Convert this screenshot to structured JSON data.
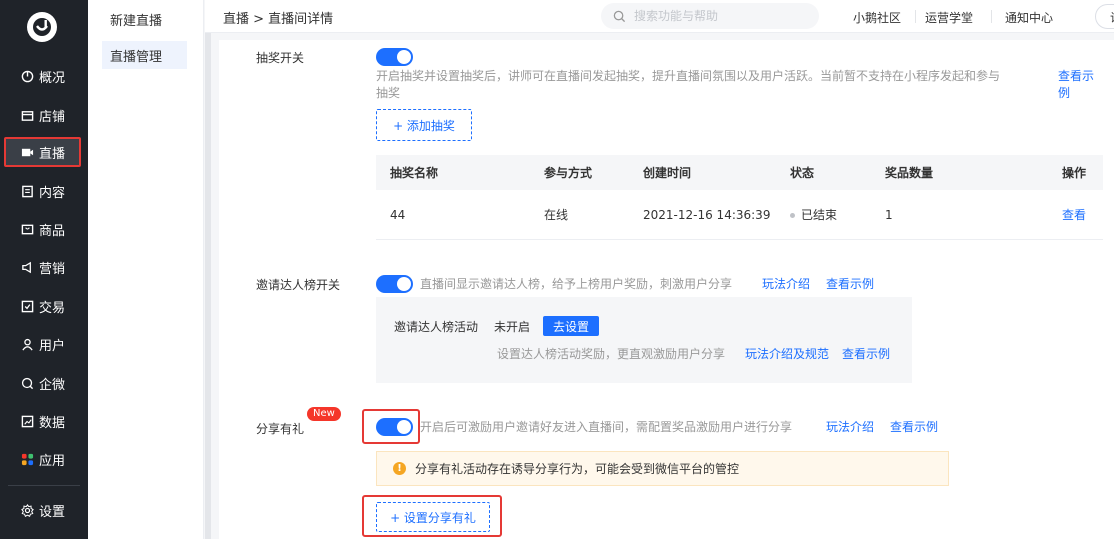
{
  "nav": {
    "items": [
      {
        "label": "概况",
        "icon": "dashboard-icon"
      },
      {
        "label": "店铺",
        "icon": "store-icon"
      },
      {
        "label": "直播",
        "icon": "live-icon"
      },
      {
        "label": "内容",
        "icon": "content-icon"
      },
      {
        "label": "商品",
        "icon": "goods-icon"
      },
      {
        "label": "营销",
        "icon": "marketing-icon"
      },
      {
        "label": "交易",
        "icon": "trade-icon"
      },
      {
        "label": "用户",
        "icon": "user-icon"
      },
      {
        "label": "企微",
        "icon": "wework-icon"
      },
      {
        "label": "数据",
        "icon": "data-icon"
      },
      {
        "label": "应用",
        "icon": "apps-icon"
      },
      {
        "label": "设置",
        "icon": "gear-icon"
      }
    ],
    "active": "直播"
  },
  "subnav": {
    "title": "新建直播",
    "item": "直播管理"
  },
  "header": {
    "breadcrumb": "直播 > 直播间详情",
    "search_placeholder": "搜索功能与帮助",
    "links": [
      "小鹅社区",
      "运营学堂",
      "通知中心"
    ],
    "trailing": "访"
  },
  "lottery": {
    "label": "抽奖开关",
    "desc_line1": "开启抽奖并设置抽奖后，讲师可在直播间发起抽奖，提升直播间氛围以及用户活跃。当前暂不支持在小程序发起和参与",
    "desc_line2": "抽奖",
    "example_line1": "查看示",
    "example_line2": "例",
    "add_button": "+ 添加抽奖",
    "table": {
      "headers": [
        "抽奖名称",
        "参与方式",
        "创建时间",
        "状态",
        "奖品数量",
        "操作"
      ],
      "rows": [
        {
          "name": "44",
          "mode": "在线",
          "created": "2021-12-16 14:36:39",
          "status": "已结束",
          "count": "1",
          "action": "查看"
        }
      ]
    }
  },
  "invite": {
    "label": "邀请达人榜开关",
    "desc": "直播间显示邀请达人榜，给予上榜用户奖励，刺激用户分享",
    "intro_link": "玩法介绍",
    "example_link": "查看示例",
    "activity_label": "邀请达人榜活动",
    "activity_status": "未开启",
    "setup_button": "去设置",
    "sub_desc": "设置达人榜活动奖励，更直观激励用户分享",
    "rules_link": "玩法介绍及规范",
    "sub_example_link": "查看示例"
  },
  "share": {
    "label": "分享有礼",
    "new_badge": "New",
    "desc": "开启后可激励用户邀请好友进入直播间，需配置奖品激励用户进行分享",
    "intro_link": "玩法介绍",
    "example_link": "查看示例",
    "warning": "分享有礼活动存在诱导分享行为，可能会受到微信平台的管控",
    "setup_button": "+ 设置分享有礼"
  },
  "colors": {
    "primary": "#1d6fff",
    "highlight": "#e53935",
    "nav_bg": "#1f2329"
  }
}
